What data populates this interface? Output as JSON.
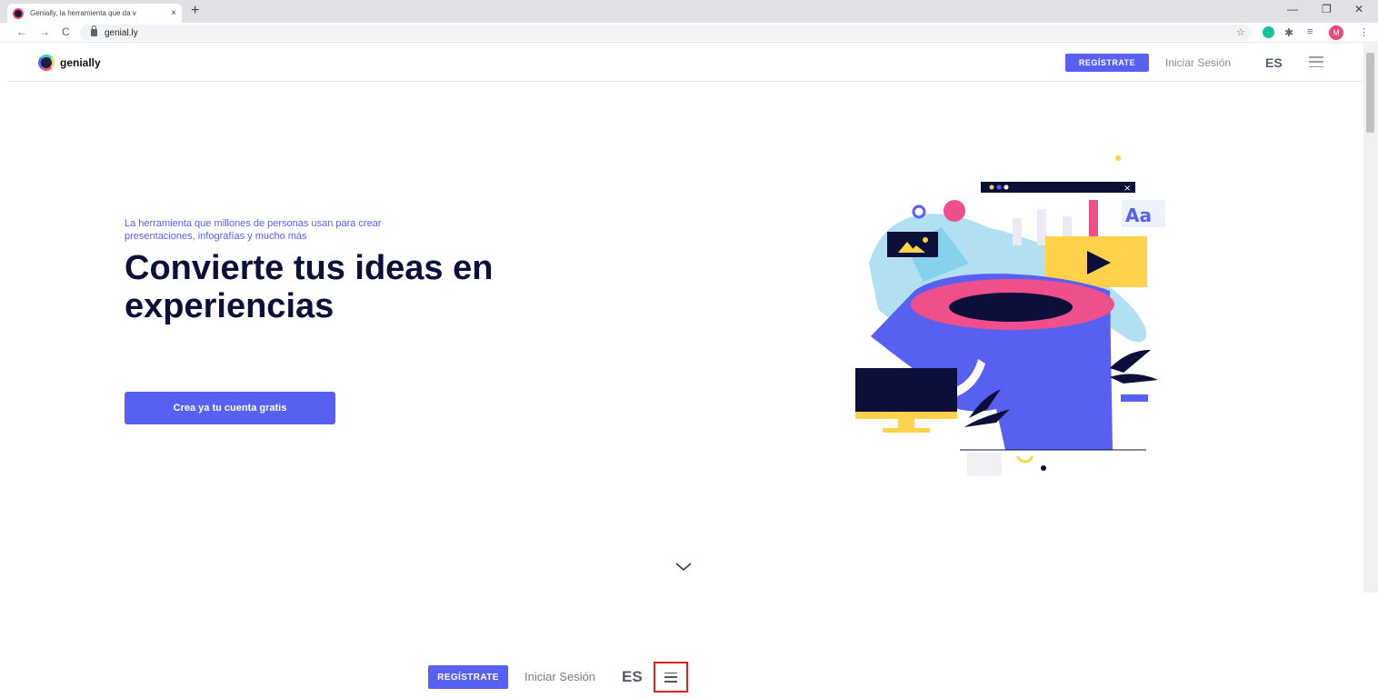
{
  "browser": {
    "tab_title": "Genially, la herramienta que da v",
    "tab_close": "×",
    "new_tab": "+",
    "url": "genial.ly",
    "back": "←",
    "forward": "→",
    "reload": "C",
    "star": "☆",
    "ext_profile": "M",
    "minimize": "—",
    "restore": "❐",
    "close": "✕",
    "more": "⋮"
  },
  "header": {
    "logo_text": "genially",
    "register_label": "REGÍSTRATE",
    "login_label": "Iniciar Sesión",
    "language": "ES"
  },
  "hero": {
    "subtitle": "La herramienta que millones de personas usan para crear presentaciones, infografías y mucho más",
    "headline": "Convierte tus ideas en experiencias",
    "cta_label": "Crea ya tu cuenta gratis",
    "illustration_text": "Aa"
  },
  "zoom_toolbar": {
    "register_label": "REGÍSTRATE",
    "login_label": "Iniciar Sesión",
    "language": "ES"
  },
  "colors": {
    "accent": "#5860f2",
    "headline": "#0b0f3a",
    "highlight_box": "#e02020"
  },
  "icons": [
    "menu-icon",
    "chevron-down-icon",
    "lock-icon",
    "star-icon",
    "extensions-icon"
  ]
}
